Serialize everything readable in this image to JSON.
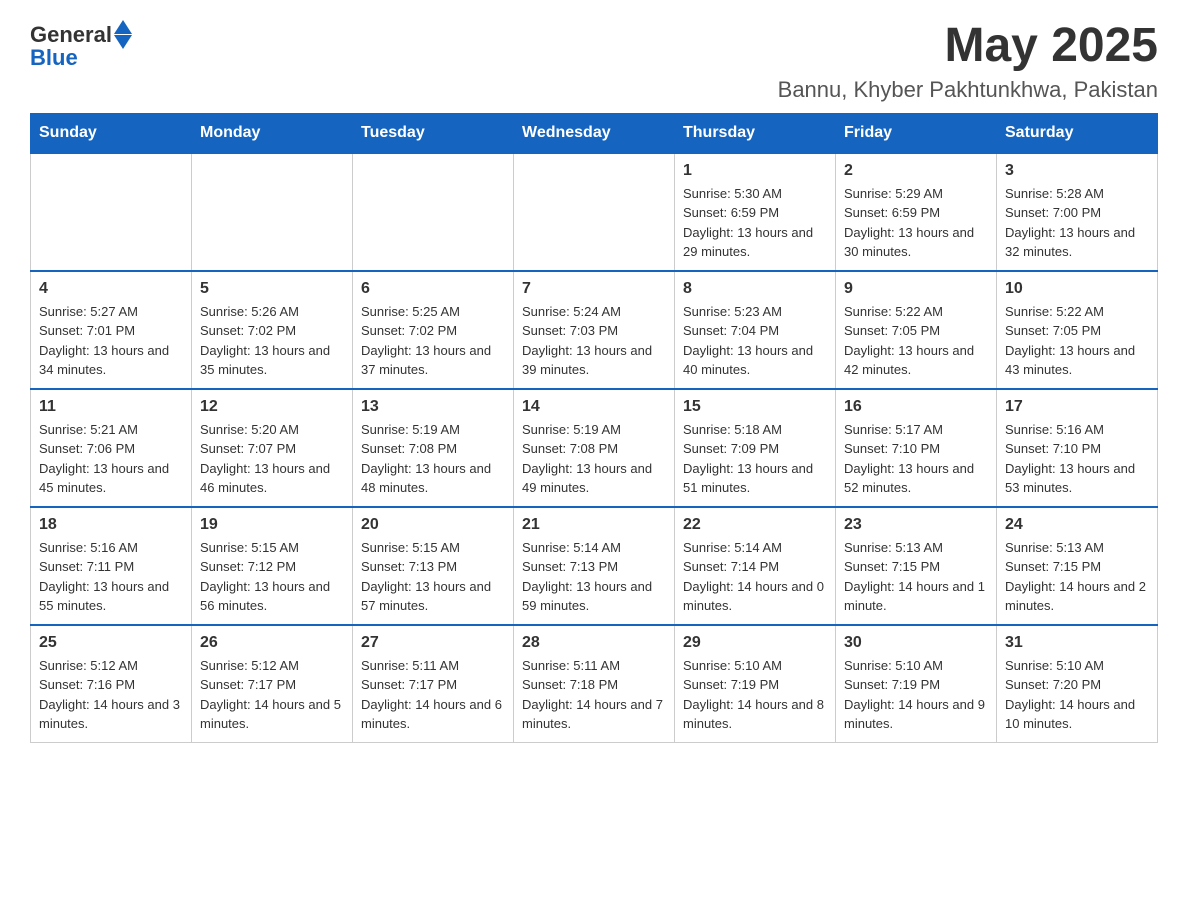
{
  "header": {
    "logo_general": "General",
    "logo_blue": "Blue",
    "month_year": "May 2025",
    "location": "Bannu, Khyber Pakhtunkhwa, Pakistan"
  },
  "days_of_week": [
    "Sunday",
    "Monday",
    "Tuesday",
    "Wednesday",
    "Thursday",
    "Friday",
    "Saturday"
  ],
  "weeks": [
    {
      "days": [
        {
          "date": "",
          "info": ""
        },
        {
          "date": "",
          "info": ""
        },
        {
          "date": "",
          "info": ""
        },
        {
          "date": "",
          "info": ""
        },
        {
          "date": "1",
          "info": "Sunrise: 5:30 AM\nSunset: 6:59 PM\nDaylight: 13 hours and 29 minutes."
        },
        {
          "date": "2",
          "info": "Sunrise: 5:29 AM\nSunset: 6:59 PM\nDaylight: 13 hours and 30 minutes."
        },
        {
          "date": "3",
          "info": "Sunrise: 5:28 AM\nSunset: 7:00 PM\nDaylight: 13 hours and 32 minutes."
        }
      ]
    },
    {
      "days": [
        {
          "date": "4",
          "info": "Sunrise: 5:27 AM\nSunset: 7:01 PM\nDaylight: 13 hours and 34 minutes."
        },
        {
          "date": "5",
          "info": "Sunrise: 5:26 AM\nSunset: 7:02 PM\nDaylight: 13 hours and 35 minutes."
        },
        {
          "date": "6",
          "info": "Sunrise: 5:25 AM\nSunset: 7:02 PM\nDaylight: 13 hours and 37 minutes."
        },
        {
          "date": "7",
          "info": "Sunrise: 5:24 AM\nSunset: 7:03 PM\nDaylight: 13 hours and 39 minutes."
        },
        {
          "date": "8",
          "info": "Sunrise: 5:23 AM\nSunset: 7:04 PM\nDaylight: 13 hours and 40 minutes."
        },
        {
          "date": "9",
          "info": "Sunrise: 5:22 AM\nSunset: 7:05 PM\nDaylight: 13 hours and 42 minutes."
        },
        {
          "date": "10",
          "info": "Sunrise: 5:22 AM\nSunset: 7:05 PM\nDaylight: 13 hours and 43 minutes."
        }
      ]
    },
    {
      "days": [
        {
          "date": "11",
          "info": "Sunrise: 5:21 AM\nSunset: 7:06 PM\nDaylight: 13 hours and 45 minutes."
        },
        {
          "date": "12",
          "info": "Sunrise: 5:20 AM\nSunset: 7:07 PM\nDaylight: 13 hours and 46 minutes."
        },
        {
          "date": "13",
          "info": "Sunrise: 5:19 AM\nSunset: 7:08 PM\nDaylight: 13 hours and 48 minutes."
        },
        {
          "date": "14",
          "info": "Sunrise: 5:19 AM\nSunset: 7:08 PM\nDaylight: 13 hours and 49 minutes."
        },
        {
          "date": "15",
          "info": "Sunrise: 5:18 AM\nSunset: 7:09 PM\nDaylight: 13 hours and 51 minutes."
        },
        {
          "date": "16",
          "info": "Sunrise: 5:17 AM\nSunset: 7:10 PM\nDaylight: 13 hours and 52 minutes."
        },
        {
          "date": "17",
          "info": "Sunrise: 5:16 AM\nSunset: 7:10 PM\nDaylight: 13 hours and 53 minutes."
        }
      ]
    },
    {
      "days": [
        {
          "date": "18",
          "info": "Sunrise: 5:16 AM\nSunset: 7:11 PM\nDaylight: 13 hours and 55 minutes."
        },
        {
          "date": "19",
          "info": "Sunrise: 5:15 AM\nSunset: 7:12 PM\nDaylight: 13 hours and 56 minutes."
        },
        {
          "date": "20",
          "info": "Sunrise: 5:15 AM\nSunset: 7:13 PM\nDaylight: 13 hours and 57 minutes."
        },
        {
          "date": "21",
          "info": "Sunrise: 5:14 AM\nSunset: 7:13 PM\nDaylight: 13 hours and 59 minutes."
        },
        {
          "date": "22",
          "info": "Sunrise: 5:14 AM\nSunset: 7:14 PM\nDaylight: 14 hours and 0 minutes."
        },
        {
          "date": "23",
          "info": "Sunrise: 5:13 AM\nSunset: 7:15 PM\nDaylight: 14 hours and 1 minute."
        },
        {
          "date": "24",
          "info": "Sunrise: 5:13 AM\nSunset: 7:15 PM\nDaylight: 14 hours and 2 minutes."
        }
      ]
    },
    {
      "days": [
        {
          "date": "25",
          "info": "Sunrise: 5:12 AM\nSunset: 7:16 PM\nDaylight: 14 hours and 3 minutes."
        },
        {
          "date": "26",
          "info": "Sunrise: 5:12 AM\nSunset: 7:17 PM\nDaylight: 14 hours and 5 minutes."
        },
        {
          "date": "27",
          "info": "Sunrise: 5:11 AM\nSunset: 7:17 PM\nDaylight: 14 hours and 6 minutes."
        },
        {
          "date": "28",
          "info": "Sunrise: 5:11 AM\nSunset: 7:18 PM\nDaylight: 14 hours and 7 minutes."
        },
        {
          "date": "29",
          "info": "Sunrise: 5:10 AM\nSunset: 7:19 PM\nDaylight: 14 hours and 8 minutes."
        },
        {
          "date": "30",
          "info": "Sunrise: 5:10 AM\nSunset: 7:19 PM\nDaylight: 14 hours and 9 minutes."
        },
        {
          "date": "31",
          "info": "Sunrise: 5:10 AM\nSunset: 7:20 PM\nDaylight: 14 hours and 10 minutes."
        }
      ]
    }
  ]
}
